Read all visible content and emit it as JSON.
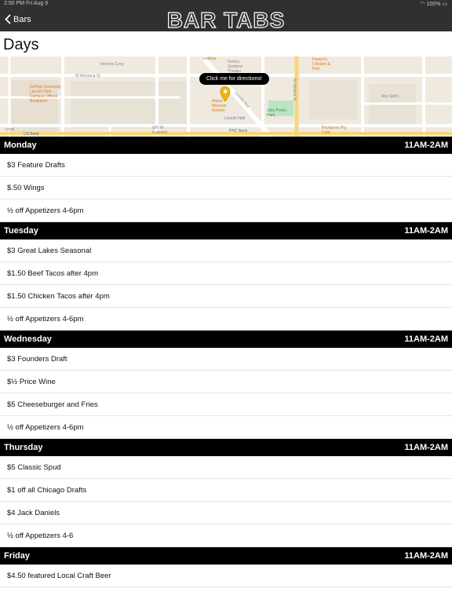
{
  "status": {
    "time": "2:50 PM  Fri Aug 9",
    "battery": "100%"
  },
  "nav": {
    "back_label": "Bars",
    "title": "BAR TABS"
  },
  "page_title": "Days",
  "map": {
    "callout": "Click me for directions!",
    "labels": {
      "intrinsic": "Intrinsic Corp",
      "montana": "W Montana St",
      "depaul": "DePaul University Lincoln Park Campus Official Bookstore",
      "institute": "Institute",
      "victory": "Victory Gardens Theater",
      "halsted": "N Halsted St",
      "parsons": "Parson's Chicken & Fish",
      "reysethi": "Rey Sethi",
      "lincoln": "Lincoln Ave",
      "alamo": "Alamo Mexican Kitchen",
      "lincolnhall": "Lincoln Hall",
      "julia": "Julia Porter Park",
      "pnc": "PNC Bank",
      "bourgeois": "Bourgeois Pig Cafe",
      "fullerton": "900 W Fullerton",
      "legal": "Legal",
      "usbank": "US Bank"
    }
  },
  "days": [
    {
      "name": "Monday",
      "hours": "11AM-2AM",
      "specials": [
        "$3 Feature Drafts",
        "$.50 Wings",
        "½ off Appetizers 4-6pm"
      ]
    },
    {
      "name": "Tuesday",
      "hours": "11AM-2AM",
      "specials": [
        "$3 Great Lakes Seasonal",
        "$1.50 Beef Tacos after 4pm",
        "$1.50 Chicken Tacos after 4pm",
        "½ off Appetizers 4-6pm"
      ]
    },
    {
      "name": "Wednesday",
      "hours": "11AM-2AM",
      "specials": [
        "$3 Founders Draft",
        "$½ Price Wine",
        "$5 Cheeseburger and Fries",
        "½ off Appetizers 4-6pm"
      ]
    },
    {
      "name": "Thursday",
      "hours": "11AM-2AM",
      "specials": [
        "$5 Classic Spud",
        "$1 off all Chicago Drafts",
        "$4 Jack Daniels",
        "½ off Appetizers 4-6"
      ]
    },
    {
      "name": "Friday",
      "hours": "11AM-2AM",
      "specials": [
        "$4.50 featured Local Craft Beer"
      ]
    }
  ],
  "colors": {
    "bar": "#303030",
    "header": "#000000",
    "pin": "#f2b705",
    "park": "#bfe3c2",
    "road_major": "#f6d77a"
  }
}
